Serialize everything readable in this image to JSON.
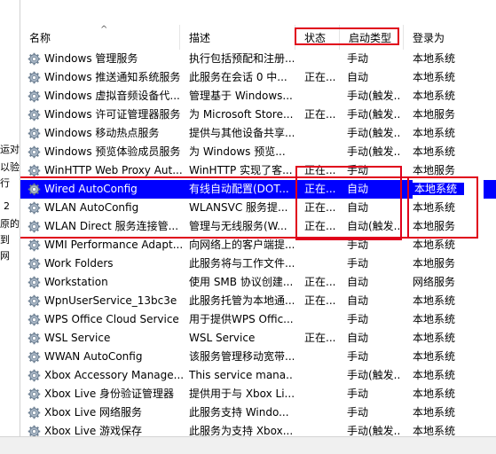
{
  "left_fragments": [
    "运对",
    "以验",
    "行",
    "2",
    "原的",
    "到",
    "网"
  ],
  "columns": {
    "name": "名称",
    "desc": "描述",
    "status": "状态",
    "start": "启动类型",
    "logon": "登录为"
  },
  "rows": [
    {
      "name": "Windows 管理服务",
      "desc": "执行包括预配和注册...",
      "status": "",
      "start": "手动",
      "logon": "本地系统"
    },
    {
      "name": "Windows 推送通知系统服务",
      "desc": "此服务在会话 0 中...",
      "status": "正在...",
      "start": "自动",
      "logon": "本地系统"
    },
    {
      "name": "Windows 虚拟音频设备代...",
      "desc": "管理基于 Windows...",
      "status": "",
      "start": "手动(触发...",
      "logon": "本地系统"
    },
    {
      "name": "Windows 许可证管理器服务",
      "desc": "为 Microsoft Store...",
      "status": "正在...",
      "start": "手动(触发...",
      "logon": "本地服务"
    },
    {
      "name": "Windows 移动热点服务",
      "desc": "提供与其他设备共享...",
      "status": "",
      "start": "手动(触发...",
      "logon": "本地系统"
    },
    {
      "name": "Windows 预览体验成员服务",
      "desc": "为 Windows 预览...",
      "status": "",
      "start": "手动(触发...",
      "logon": "本地系统"
    },
    {
      "name": "WinHTTP Web Proxy Aut...",
      "desc": "WinHTTP 实现了客...",
      "status": "正在...",
      "start": "手动",
      "logon": "本地服务"
    },
    {
      "name": "Wired AutoConfig",
      "desc": "有线自动配置(DOT...",
      "status": "正在...",
      "start": "自动",
      "logon": "本地系统"
    },
    {
      "name": "WLAN AutoConfig",
      "desc": "WLANSVC 服务提...",
      "status": "正在...",
      "start": "自动",
      "logon": "本地系统"
    },
    {
      "name": "WLAN Direct 服务连接管...",
      "desc": "管理与无线服务(W...",
      "status": "正在...",
      "start": "自动(触发...",
      "logon": "本地服务"
    },
    {
      "name": "WMI Performance Adapt...",
      "desc": "向网络上的客户端提...",
      "status": "",
      "start": "手动",
      "logon": "本地系统"
    },
    {
      "name": "Work Folders",
      "desc": "此服务将与工作文件...",
      "status": "",
      "start": "手动",
      "logon": "本地服务"
    },
    {
      "name": "Workstation",
      "desc": "使用 SMB 协议创建...",
      "status": "正在...",
      "start": "自动",
      "logon": "网络服务"
    },
    {
      "name": "WpnUserService_13bc3e",
      "desc": "此服务托管为本地通...",
      "status": "正在...",
      "start": "自动",
      "logon": "本地系统"
    },
    {
      "name": "WPS Office Cloud Service",
      "desc": "用于提供WPS Offic...",
      "status": "",
      "start": "手动",
      "logon": "本地系统"
    },
    {
      "name": "WSL Service",
      "desc": "WSL Service",
      "status": "正在...",
      "start": "自动",
      "logon": "本地系统"
    },
    {
      "name": "WWAN AutoConfig",
      "desc": "该服务管理移动宽带...",
      "status": "",
      "start": "手动",
      "logon": "本地系统"
    },
    {
      "name": "Xbox Accessory Manage...",
      "desc": "This service mana...",
      "status": "",
      "start": "手动(触发...",
      "logon": "本地系统"
    },
    {
      "name": "Xbox Live 身份验证管理器",
      "desc": "提供用于与 Xbox Li...",
      "status": "",
      "start": "手动",
      "logon": "本地系统"
    },
    {
      "name": "Xbox Live 网络服务",
      "desc": "此服务支持 Windo...",
      "status": "",
      "start": "手动",
      "logon": "本地系统"
    },
    {
      "name": "Xbox Live 游戏保存",
      "desc": "此服务为支持 Xbox...",
      "status": "",
      "start": "手动(触发...",
      "logon": "本地系统"
    }
  ],
  "selected_row": 7,
  "colors": {
    "selection": "#0000ff",
    "highlight_box": "#e0001b"
  }
}
